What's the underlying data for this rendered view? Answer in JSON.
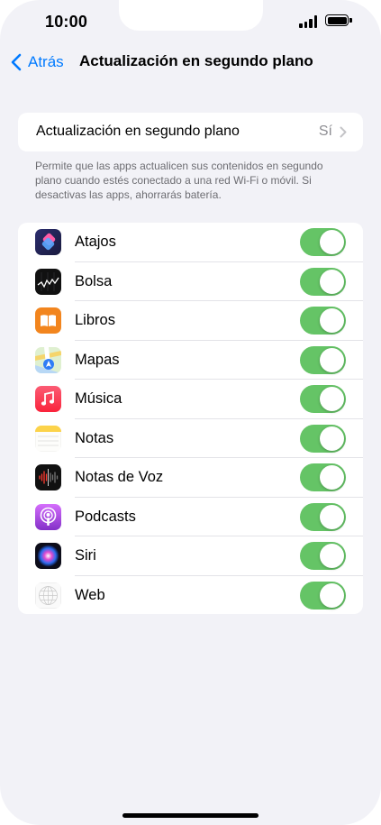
{
  "status_bar": {
    "time": "10:00"
  },
  "nav": {
    "back_label": "Atrás",
    "title": "Actualización en segundo plano"
  },
  "main_setting": {
    "label": "Actualización en segundo plano",
    "value": "Sí"
  },
  "footnote": "Permite que las apps actualicen sus contenidos en segundo plano cuando estés conectado a una red Wi-Fi o móvil. Si desactivas las apps, ahorrarás batería.",
  "apps": [
    {
      "label": "Atajos",
      "icon": "shortcuts-icon",
      "enabled": true
    },
    {
      "label": "Bolsa",
      "icon": "stocks-icon",
      "enabled": true
    },
    {
      "label": "Libros",
      "icon": "books-icon",
      "enabled": true
    },
    {
      "label": "Mapas",
      "icon": "maps-icon",
      "enabled": true
    },
    {
      "label": "Música",
      "icon": "music-icon",
      "enabled": true
    },
    {
      "label": "Notas",
      "icon": "notes-icon",
      "enabled": true
    },
    {
      "label": "Notas de Voz",
      "icon": "voice-memos-icon",
      "enabled": true
    },
    {
      "label": "Podcasts",
      "icon": "podcasts-icon",
      "enabled": true
    },
    {
      "label": "Siri",
      "icon": "siri-icon",
      "enabled": true
    },
    {
      "label": "Web",
      "icon": "web-icon",
      "enabled": true
    }
  ],
  "colors": {
    "accent": "#007aff",
    "toggle_on": "#65c466",
    "background": "#f2f2f7"
  }
}
